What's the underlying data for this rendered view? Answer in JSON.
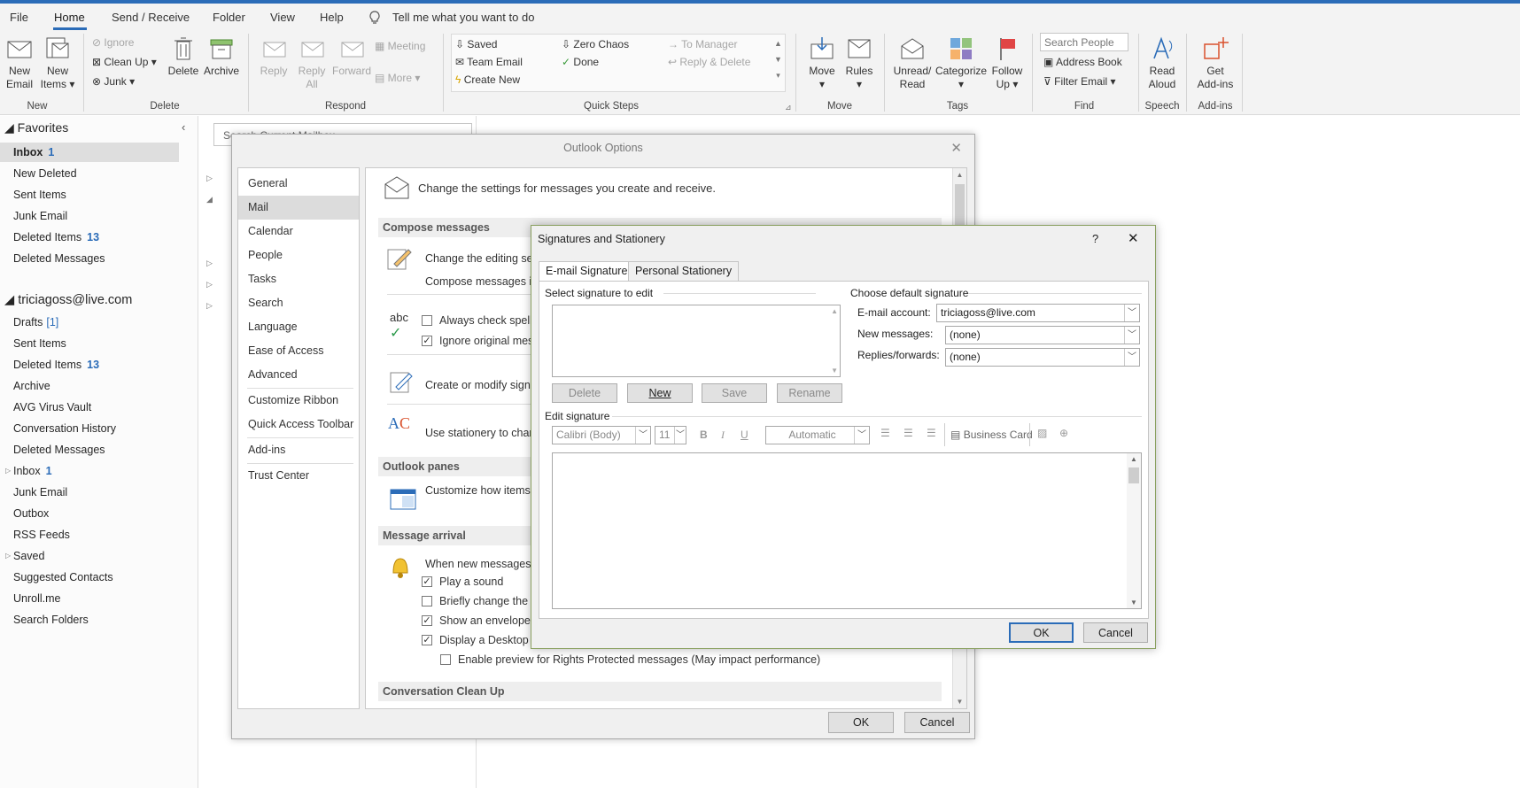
{
  "menubar": {
    "file": "File",
    "home": "Home",
    "send_receive": "Send / Receive",
    "folder": "Folder",
    "view": "View",
    "help": "Help",
    "tell_me": "Tell me what you want to do"
  },
  "ribbon": {
    "new_email": [
      "New",
      "Email"
    ],
    "new_items": [
      "New",
      "Items"
    ],
    "ignore": "Ignore",
    "clean_up": "Clean Up",
    "junk": "Junk",
    "delete": "Delete",
    "archive": "Archive",
    "reply": "Reply",
    "reply_all": [
      "Reply",
      "All"
    ],
    "forward": "Forward",
    "meeting": "Meeting",
    "more": "More",
    "qs_saved": "Saved",
    "qs_team_email": "Team Email",
    "qs_create_new": "Create New",
    "qs_zero_chaos": "Zero Chaos",
    "qs_done": "Done",
    "qs_to_manager": "To Manager",
    "qs_reply_delete": "Reply & Delete",
    "move": "Move",
    "rules": "Rules",
    "unread_read": [
      "Unread/",
      "Read"
    ],
    "categorize": "Categorize",
    "follow_up": [
      "Follow",
      "Up"
    ],
    "search_people_placeholder": "Search People",
    "address_book": "Address Book",
    "filter_email": "Filter Email",
    "read_aloud": [
      "Read",
      "Aloud"
    ],
    "get_addins": [
      "Get",
      "Add-ins"
    ],
    "groups": {
      "new": "New",
      "delete": "Delete",
      "respond": "Respond",
      "quick_steps": "Quick Steps",
      "move": "Move",
      "tags": "Tags",
      "find": "Find",
      "speech": "Speech",
      "addins": "Add-ins"
    }
  },
  "sidebar": {
    "favorites_label": "Favorites",
    "favorites": [
      {
        "label": "Inbox",
        "count": "1"
      },
      {
        "label": "New Deleted",
        "count": ""
      },
      {
        "label": "Sent Items",
        "count": ""
      },
      {
        "label": "Junk Email",
        "count": ""
      },
      {
        "label": "Deleted Items",
        "count": "13"
      },
      {
        "label": "Deleted Messages",
        "count": ""
      }
    ],
    "account_label": "triciagoss@live.com",
    "account_items": [
      {
        "label": "Drafts",
        "count": "[1]"
      },
      {
        "label": "Sent Items",
        "count": ""
      },
      {
        "label": "Deleted Items",
        "count": "13"
      },
      {
        "label": "Archive",
        "count": ""
      },
      {
        "label": "AVG Virus Vault",
        "count": ""
      },
      {
        "label": "Conversation History",
        "count": ""
      },
      {
        "label": "Deleted Messages",
        "count": ""
      },
      {
        "label": "Inbox",
        "count": "1"
      },
      {
        "label": "Junk Email",
        "count": ""
      },
      {
        "label": "Outbox",
        "count": ""
      },
      {
        "label": "RSS Feeds",
        "count": ""
      },
      {
        "label": "Saved",
        "count": ""
      },
      {
        "label": "Suggested Contacts",
        "count": ""
      },
      {
        "label": "Unroll.me",
        "count": ""
      },
      {
        "label": "Search Folders",
        "count": ""
      }
    ]
  },
  "search_current_placeholder": "Search Current Mailbox",
  "options": {
    "title": "Outlook Options",
    "nav": [
      "General",
      "Mail",
      "Calendar",
      "People",
      "Tasks",
      "Search",
      "Language",
      "Ease of Access",
      "Advanced",
      "Customize Ribbon",
      "Quick Access Toolbar",
      "Add-ins",
      "Trust Center"
    ],
    "header": "Change the settings for messages you create and receive.",
    "compose_head": "Compose messages",
    "compose_line1": "Change the editing set",
    "compose_line2": "Compose messages in",
    "always_check": "Always check spelli",
    "ignore_original": "Ignore original mes",
    "create_modify": "Create or modify signa",
    "use_stationery": "Use stationery to chan",
    "panes_head": "Outlook panes",
    "customize_items": "Customize how items",
    "arrival_head": "Message arrival",
    "when_new": "When new messages a",
    "play_sound": "Play a sound",
    "briefly_change": "Briefly change the",
    "show_envelope": "Show an envelope",
    "display_desktop": "Display a Desktop A",
    "enable_preview": "Enable preview for Rights Protected messages (May impact performance)",
    "cleanup_head": "Conversation Clean Up",
    "ok": "OK",
    "cancel": "Cancel"
  },
  "signatures": {
    "title": "Signatures and Stationery",
    "help": "?",
    "tab_email": "E-mail Signature",
    "tab_stationery": "Personal Stationery",
    "select_label": "Select signature to edit",
    "choose_default": "Choose default signature",
    "email_account_label": "E-mail account:",
    "email_account_value": "triciagoss@live.com",
    "new_messages_label": "New messages:",
    "new_messages_value": "(none)",
    "replies_label": "Replies/forwards:",
    "replies_value": "(none)",
    "btn_delete": "Delete",
    "btn_new": "New",
    "btn_save": "Save",
    "btn_rename": "Rename",
    "edit_label": "Edit signature",
    "font_value": "Calibri (Body)",
    "size_value": "11",
    "color_value": "Automatic",
    "business_card": "Business Card",
    "ok": "OK",
    "cancel": "Cancel"
  },
  "colors": {
    "accent": "#2b6cb8",
    "count": "#2b6cb8",
    "ribbon_bg": "#f3f3f3"
  }
}
